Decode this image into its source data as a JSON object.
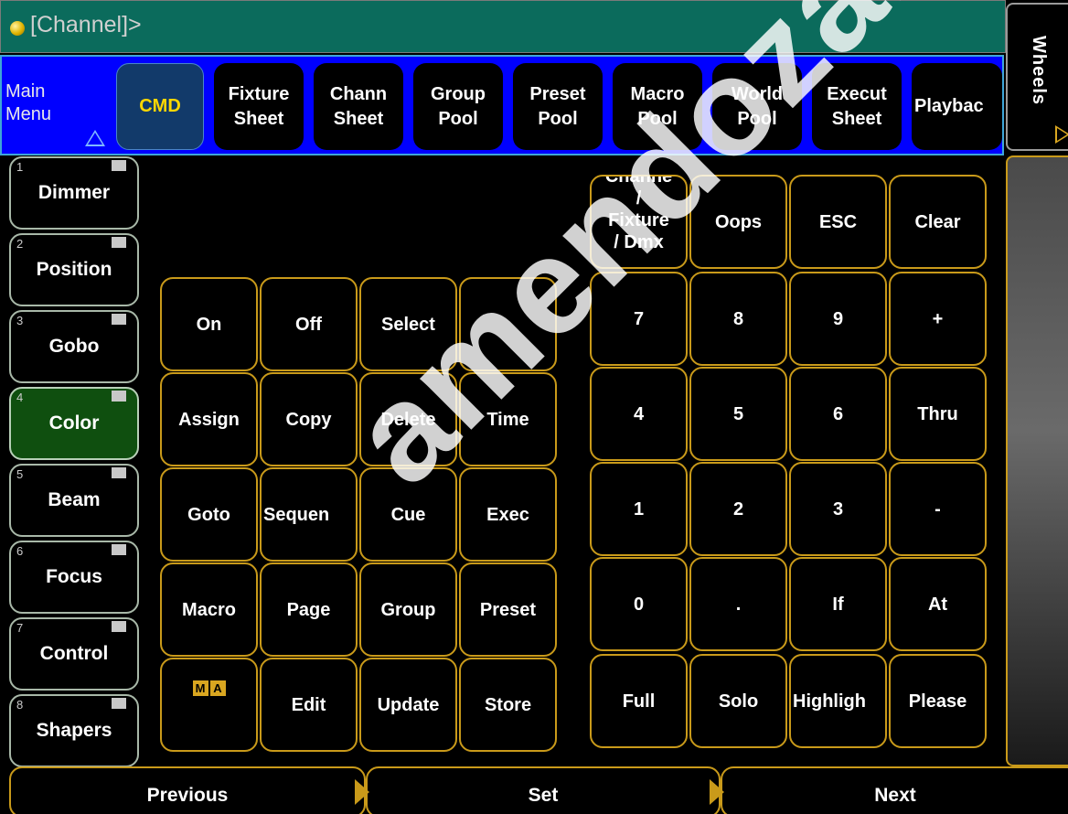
{
  "command_line": {
    "text": "[Channel]>"
  },
  "main_menu": {
    "label": "Main\nMenu",
    "items": [
      {
        "label": "CMD",
        "active": true
      },
      {
        "label": "Fixture\nSheet"
      },
      {
        "label": "Chann\nSheet"
      },
      {
        "label": "Group\nPool"
      },
      {
        "label": "Preset\nPool"
      },
      {
        "label": "Macro\nPool"
      },
      {
        "label": "World\nPool"
      },
      {
        "label": "Execut\nSheet"
      },
      {
        "label": "Playbac"
      }
    ]
  },
  "wheels_tab": {
    "label": "Wheels"
  },
  "preset_types": [
    {
      "num": "1",
      "label": "Dimmer"
    },
    {
      "num": "2",
      "label": "Position"
    },
    {
      "num": "3",
      "label": "Gobo"
    },
    {
      "num": "4",
      "label": "Color",
      "active": true
    },
    {
      "num": "5",
      "label": "Beam"
    },
    {
      "num": "6",
      "label": "Focus"
    },
    {
      "num": "7",
      "label": "Control"
    },
    {
      "num": "8",
      "label": "Shapers"
    }
  ],
  "command_keys": [
    [
      "On",
      "Off",
      "Select",
      ""
    ],
    [
      "Assign",
      "Copy",
      "Delete",
      "Time"
    ],
    [
      "Goto",
      "Sequen",
      "Cue",
      "Exec"
    ],
    [
      "Macro",
      "Page",
      "Group",
      "Preset"
    ],
    [
      "MA",
      "Edit",
      "Update",
      "Store"
    ]
  ],
  "keypad": [
    [
      "Channe\n/\nFixture\n/ Dmx",
      "Oops",
      "ESC",
      "Clear"
    ],
    [
      "7",
      "8",
      "9",
      "+"
    ],
    [
      "4",
      "5",
      "6",
      "Thru"
    ],
    [
      "1",
      "2",
      "3",
      "-"
    ],
    [
      "0",
      ".",
      "If",
      "At"
    ],
    [
      "Full",
      "Solo",
      "Highligh",
      "Please"
    ]
  ],
  "bottom_bar": {
    "previous": "Previous",
    "set": "Set",
    "next": "Next"
  },
  "watermark": "amendoza.com",
  "colors": {
    "command_line_bg": "#0b6b5c",
    "menu_bg": "#0000ff",
    "key_border": "#c99a1a",
    "active_preset_bg": "#0f4f0f",
    "active_menu_text": "#ffd700"
  }
}
